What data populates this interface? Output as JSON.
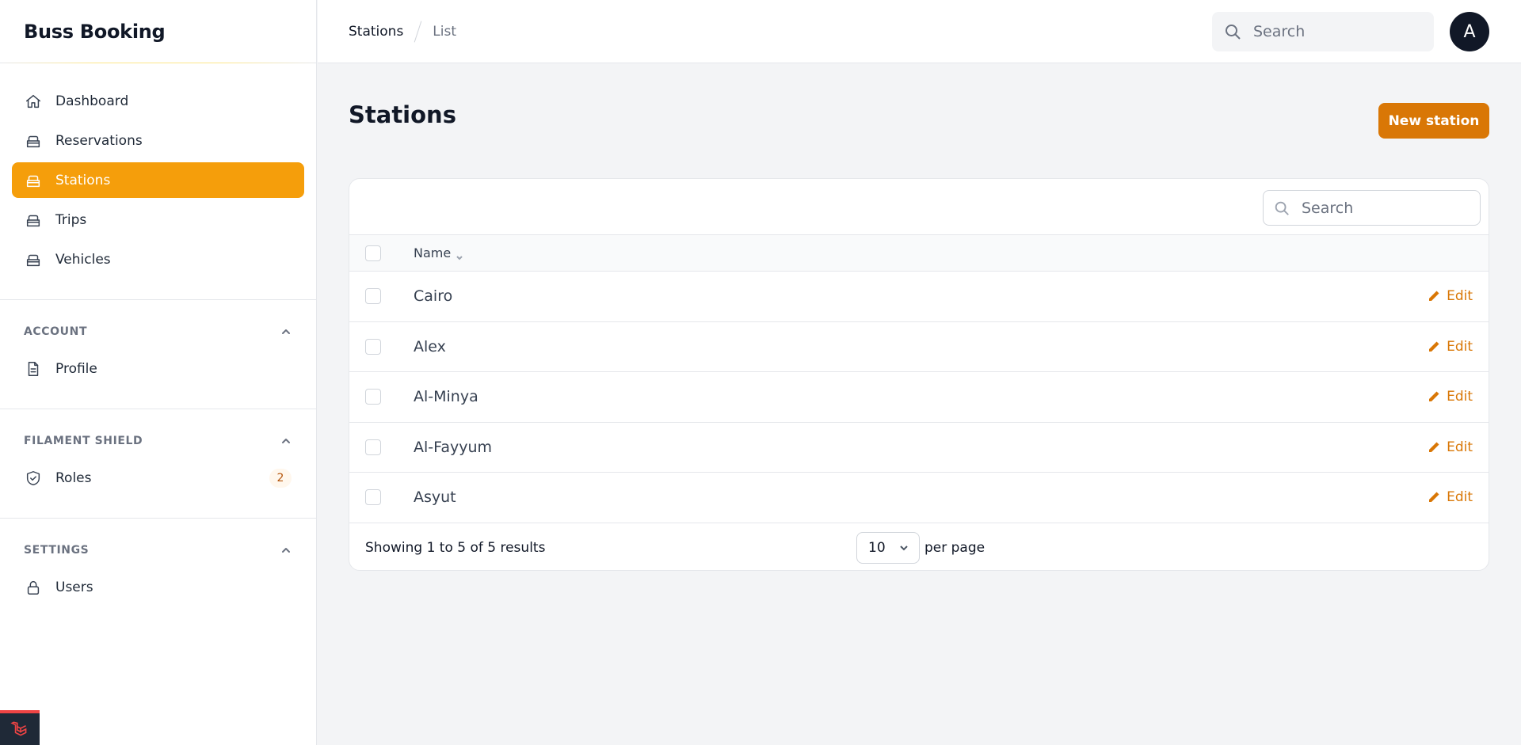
{
  "app": {
    "title": "Buss Booking"
  },
  "sidebar": {
    "items": [
      {
        "label": "Dashboard",
        "icon": "home-icon",
        "active": false
      },
      {
        "label": "Reservations",
        "icon": "archive-icon",
        "active": false
      },
      {
        "label": "Stations",
        "icon": "archive-icon",
        "active": true
      },
      {
        "label": "Trips",
        "icon": "archive-icon",
        "active": false
      },
      {
        "label": "Vehicles",
        "icon": "archive-icon",
        "active": false
      }
    ],
    "groups": [
      {
        "title": "ACCOUNT",
        "items": [
          {
            "label": "Profile",
            "icon": "document-icon"
          }
        ]
      },
      {
        "title": "FILAMENT SHIELD",
        "items": [
          {
            "label": "Roles",
            "icon": "shield-check-icon",
            "badge": "2"
          }
        ]
      },
      {
        "title": "SETTINGS",
        "items": [
          {
            "label": "Users",
            "icon": "lock-icon"
          }
        ]
      }
    ]
  },
  "topbar": {
    "breadcrumb": [
      "Stations",
      "List"
    ],
    "search_placeholder": "Search",
    "avatar_initial": "A"
  },
  "main": {
    "title": "Stations",
    "new_button_label": "New station",
    "table": {
      "search_placeholder": "Search",
      "columns": [
        "Name"
      ],
      "rows": [
        {
          "name": "Cairo",
          "action": "Edit"
        },
        {
          "name": "Alex",
          "action": "Edit"
        },
        {
          "name": "Al-Minya",
          "action": "Edit"
        },
        {
          "name": "Al-Fayyum",
          "action": "Edit"
        },
        {
          "name": "Asyut",
          "action": "Edit"
        }
      ],
      "footer": {
        "showing_text": "Showing 1 to 5 of 5 results",
        "per_page_value": "10",
        "per_page_label": "per page"
      }
    }
  },
  "colors": {
    "accent": "#f59e0b",
    "button": "#d97706",
    "badge_bg": "#fff7ed",
    "badge_text": "#b45309"
  }
}
